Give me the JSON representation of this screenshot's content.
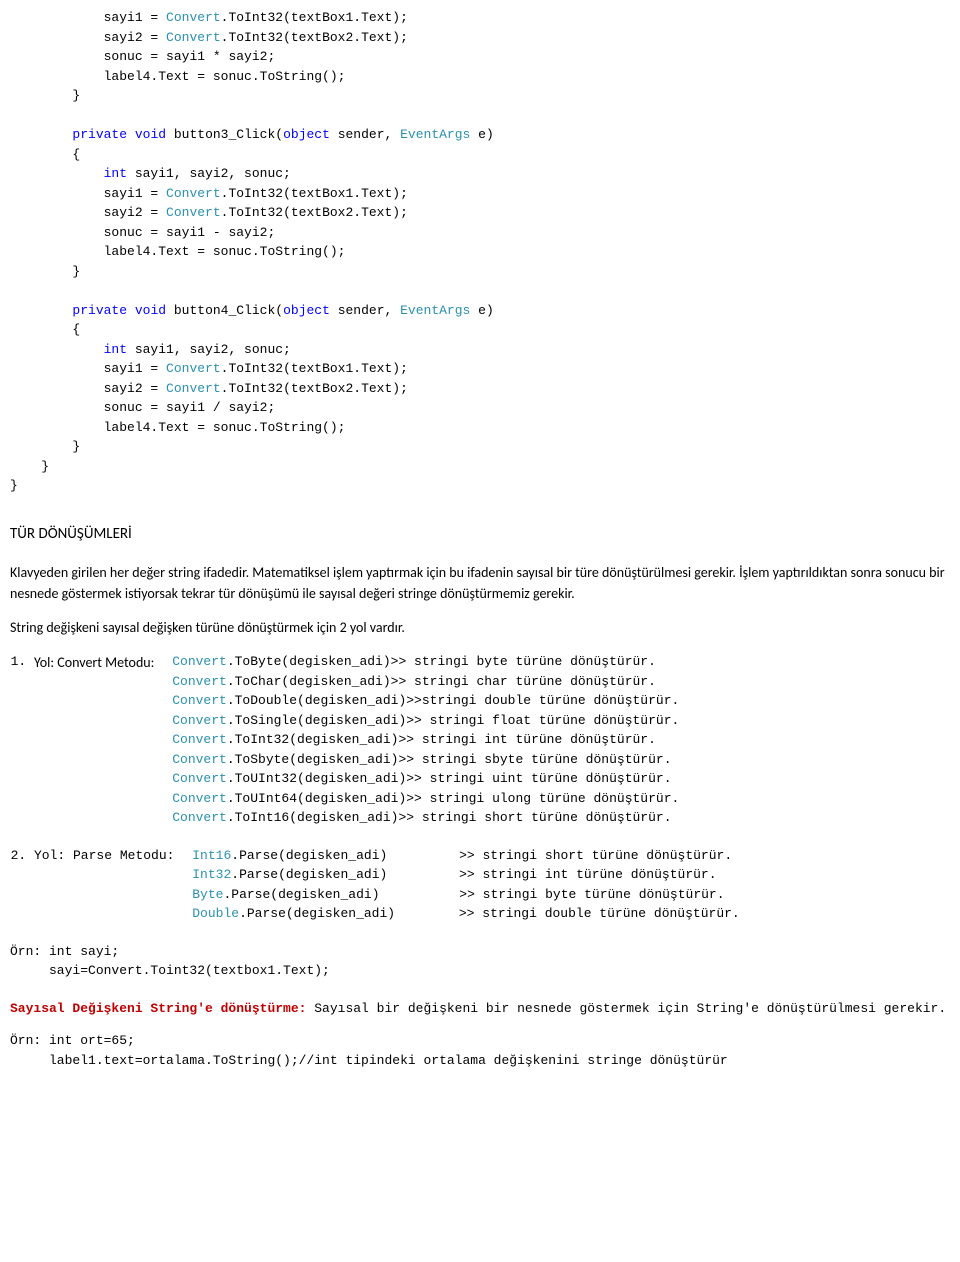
{
  "code": {
    "block0": {
      "l1a": "sayi1 = ",
      "l1b": "Convert",
      "l1c": ".ToInt32(textBox1.Text);",
      "l2a": "sayi2 = ",
      "l2b": "Convert",
      "l2c": ".ToInt32(textBox2.Text);",
      "l3": "sonuc = sayi1 * sayi2;",
      "l4": "label4.Text = sonuc.ToString();"
    },
    "sig3": {
      "a": "private",
      "b": "void",
      "c": " button3_Click(",
      "d": "object",
      "e": " sender, ",
      "f": "EventArgs",
      "g": " e)"
    },
    "block3": {
      "l0a": "int",
      "l0b": " sayi1, sayi2, sonuc;",
      "l1a": "sayi1 = ",
      "l1b": "Convert",
      "l1c": ".ToInt32(textBox1.Text);",
      "l2a": "sayi2 = ",
      "l2b": "Convert",
      "l2c": ".ToInt32(textBox2.Text);",
      "l3": "sonuc = sayi1 - sayi2;",
      "l4": "label4.Text = sonuc.ToString();"
    },
    "sig4": {
      "a": "private",
      "b": "void",
      "c": " button4_Click(",
      "d": "object",
      "e": " sender, ",
      "f": "EventArgs",
      "g": " e)"
    },
    "block4": {
      "l0a": "int",
      "l0b": " sayi1, sayi2, sonuc;",
      "l1a": "sayi1 = ",
      "l1b": "Convert",
      "l1c": ".ToInt32(textBox1.Text);",
      "l2a": "sayi2 = ",
      "l2b": "Convert",
      "l2c": ".ToInt32(textBox2.Text);",
      "l3": "sonuc = sayi1 / sayi2;",
      "l4": "label4.Text = sonuc.ToString();"
    }
  },
  "prose": {
    "heading": "TÜR DÖNÜŞÜMLERİ",
    "p1": "Klavyeden girilen her değer string ifadedir. Matematiksel işlem yaptırmak için bu ifadenin sayısal bir türe dönüştürülmesi gerekir. İşlem yaptırıldıktan sonra sonucu bir nesnede göstermek istiyorsak tekrar tür dönüşümü ile sayısal değeri stringe dönüştürmemiz gerekir.",
    "p2": "String değişkeni sayısal değişken türüne dönüştürmek için 2 yol vardır."
  },
  "methods": {
    "m1_label": "Yol: Convert Metodu:",
    "m2_label": "Yol: Parse Metodu:",
    "convert": [
      {
        "a": "Convert",
        "b": ".ToByte(degisken_adi)>> stringi byte türüne dönüştürür."
      },
      {
        "a": "Convert",
        "b": ".ToChar(degisken_adi)>> stringi char türüne dönüştürür."
      },
      {
        "a": "Convert",
        "b": ".ToDouble(degisken_adi)>>stringi double türüne dönüştürür."
      },
      {
        "a": "Convert",
        "b": ".ToSingle(degisken_adi)>> stringi float türüne dönüştürür."
      },
      {
        "a": "Convert",
        "b": ".ToInt32(degisken_adi)>> stringi int türüne dönüştürür."
      },
      {
        "a": "Convert",
        "b": ".ToSbyte(degisken_adi)>> stringi sbyte türüne dönüştürür."
      },
      {
        "a": "Convert",
        "b": ".ToUInt32(degisken_adi)>> stringi uint türüne dönüştürür."
      },
      {
        "a": "Convert",
        "b": ".ToUInt64(degisken_adi)>> stringi ulong türüne dönüştürür."
      },
      {
        "a": "Convert",
        "b": ".ToInt16(degisken_adi)>> stringi short türüne dönüştürür."
      }
    ],
    "parse": [
      {
        "a": "Int16",
        "b": ".Parse(degisken_adi)",
        "c": ">> stringi short türüne dönüştürür."
      },
      {
        "a": "Int32",
        "b": ".Parse(degisken_adi)",
        "c": ">> stringi int türüne dönüştürür."
      },
      {
        "a": "Byte",
        "b": ".Parse(degisken_adi)",
        "c": ">> stringi byte türüne dönüştürür."
      },
      {
        "a": "Double",
        "b": ".Parse(degisken_adi)",
        "c": ">> stringi double türüne dönüştürür."
      }
    ]
  },
  "example1": {
    "l1": "Örn: int sayi;",
    "l2": "     sayi=Convert.Toint32(textbox1.Text);"
  },
  "section2": {
    "titleRed": "Sayısal Değişkeni String'e dönüştürme:",
    "rest": " Sayısal bir değişkeni bir nesnede göstermek için String'e dönüştürülmesi gerekir."
  },
  "example2": {
    "l1": "Örn: int ort=65;",
    "l2": "     label1.text=ortalama.ToString();//int tipindeki ortalama değişkenini stringe dönüştürür"
  }
}
